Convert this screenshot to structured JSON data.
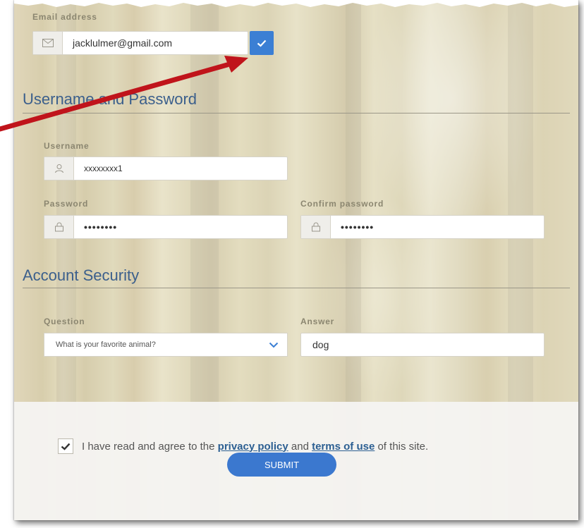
{
  "email": {
    "label": "Email address",
    "value": "jacklulmer@gmail.com",
    "icon": "envelope-icon",
    "confirm_icon": "checkmark-icon"
  },
  "section_credentials": {
    "title": "Username and Password"
  },
  "username": {
    "label": "Username",
    "value": "xxxxxxxx1",
    "icon": "user-icon"
  },
  "password": {
    "label": "Password",
    "value": "••••••••",
    "icon": "lock-icon"
  },
  "confirm_password": {
    "label": "Confirm password",
    "value": "••••••••",
    "icon": "lock-icon"
  },
  "section_security": {
    "title": "Account Security"
  },
  "question": {
    "label": "Question",
    "selected": "What is your favorite animal?",
    "icon": "chevron-down-icon"
  },
  "answer": {
    "label": "Answer",
    "value": "dog"
  },
  "agreement": {
    "prefix": "I have read and agree to the",
    "privacy_link": "privacy policy",
    "middle": "and",
    "terms_link": "terms of use",
    "suffix": "of this site.",
    "checked": true
  },
  "submit": {
    "label": "SUBMIT"
  },
  "colors": {
    "accent": "#3b7fd4",
    "section_title": "#3b5f8c",
    "link": "#2c5f92",
    "arrow": "#c0141b"
  }
}
